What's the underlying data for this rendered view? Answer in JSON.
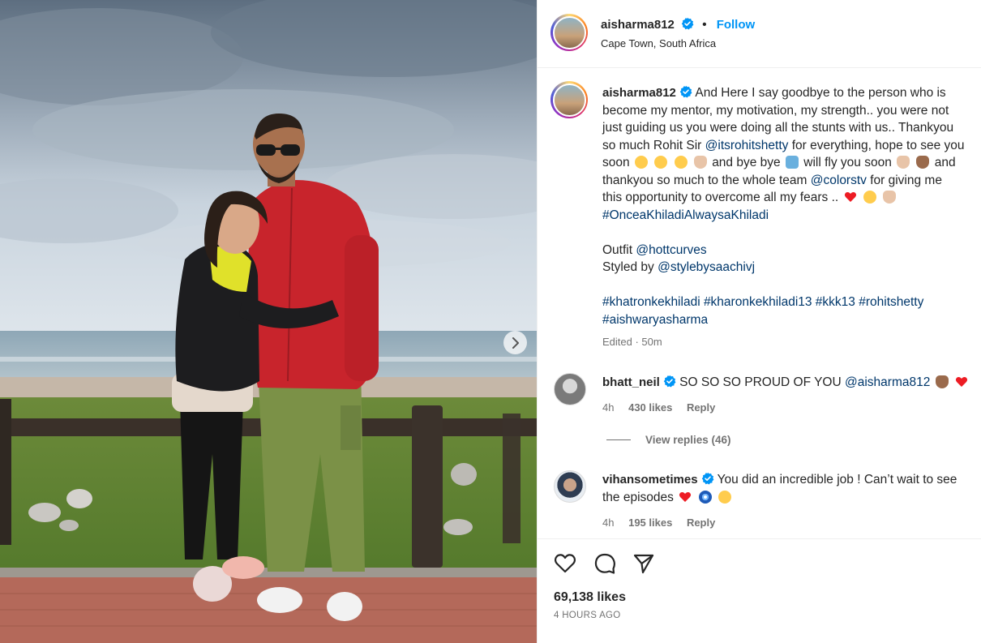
{
  "post": {
    "author": "aisharma812",
    "follow_label": "Follow",
    "location": "Cape Town, South Africa",
    "caption_lines": [
      "And Here I say goodbye to the person who is",
      "become my mentor, my motivation, my strength.. you were not",
      "just guiding us you were doing all the stunts with us.. Thankyou",
      "so much Rohit Sir",
      "for everything, hope to see you",
      "soon",
      "and bye bye",
      "will fly you soon",
      "and",
      "thankyou so much to the whole team",
      "for giving me",
      "this opportunity to overcome all my fears .."
    ],
    "mention_rohit": "@itsrohitshetty",
    "mention_colors": "@colorstv",
    "hashtag_main": "#OnceaKhiladiAlwaysaKhiladi",
    "outfit_label": "Outfit",
    "outfit_mention": "@hottcurves",
    "styled_label": "Styled by",
    "styled_mention": "@stylebysaachivj",
    "hashtags_line1": "#khatronkekhiladi #kharonkekhiladi13 #kkk13 #rohitshetty",
    "hashtags_line2": "#aishwaryasharma",
    "edited": "Edited · 50m",
    "likes": "69,138 likes",
    "time_ago": "4 HOURS AGO"
  },
  "comments": [
    {
      "user": "bhatt_neil",
      "text": "SO SO SO PROUD OF YOU",
      "mention": "@aisharma812",
      "age": "4h",
      "likes": "430 likes",
      "reply": "Reply"
    },
    {
      "user": "vihansometimes",
      "text_line1": "You did an incredible job ! Can’t wait to see",
      "text_line2": "the episodes",
      "age": "4h",
      "likes": "195 likes",
      "reply": "Reply"
    }
  ],
  "view_replies": "View replies (46)",
  "colors": {
    "link": "#00376b",
    "follow": "#0095f6",
    "verified": "#0095f6",
    "muted": "#737373",
    "heart": "#ed1c24"
  },
  "icons": [
    "chevron-right-icon",
    "verified-icon",
    "heart-icon",
    "comment-icon",
    "share-icon"
  ]
}
